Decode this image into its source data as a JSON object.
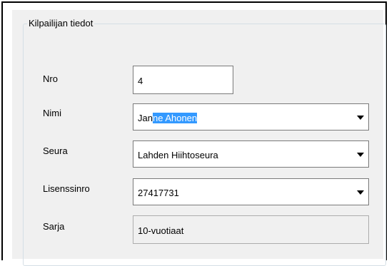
{
  "group": {
    "title": "Kilpailijan tiedot"
  },
  "fields": {
    "nro": {
      "label": "Nro",
      "value": "4"
    },
    "nimi": {
      "label": "Nimi",
      "value_plain": "Jan",
      "value_selected": "ne Ahonen"
    },
    "seura": {
      "label": "Seura",
      "value": "Lahden Hiihtoseura"
    },
    "lisenssinro": {
      "label": "Lisenssinro",
      "value": "27417731"
    },
    "sarja": {
      "label": "Sarja",
      "value": "10-vuotiaat"
    }
  },
  "icons": {
    "dropdown": "chevron-down-icon"
  }
}
